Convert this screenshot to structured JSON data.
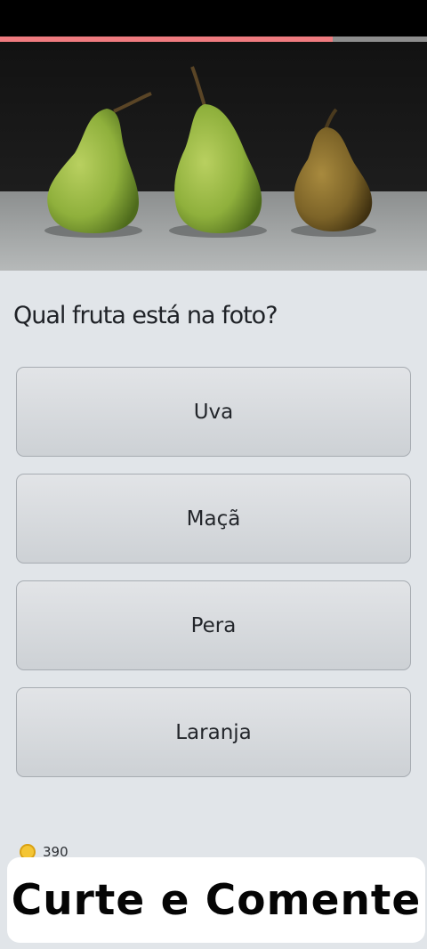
{
  "quiz": {
    "progress": 0.78,
    "question": "Qual fruta está na foto?",
    "image_alt": "pears",
    "options": [
      {
        "label": "Uva"
      },
      {
        "label": "Maçã"
      },
      {
        "label": "Pera"
      },
      {
        "label": "Laranja"
      }
    ],
    "score": "390",
    "score_icon": "coin-icon"
  },
  "overlay": {
    "text": "Curte e Comente"
  },
  "colors": {
    "progress": "#ef7b7f",
    "background": "#e1e5e9",
    "option_border": "#a7acb2"
  }
}
